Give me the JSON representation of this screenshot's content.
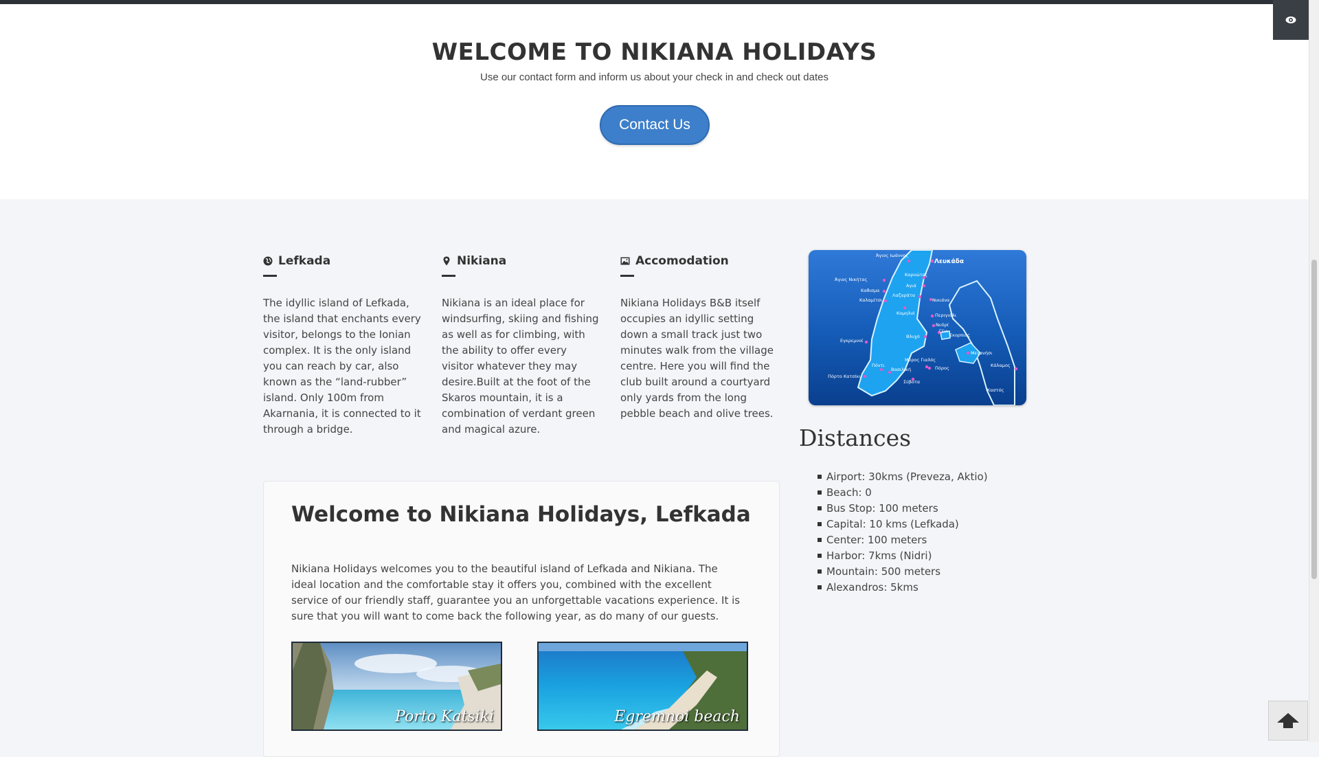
{
  "hero": {
    "title": "WELCOME TO NIKIANA HOLIDAYS",
    "subtitle": "Use our contact form and inform us about your check in and check out dates",
    "button_label": "Contact Us"
  },
  "columns": [
    {
      "icon": "globe-icon",
      "title": "Lefkada",
      "text": "The idyllic island of Lefkada, the island that enchants every visitor, belongs to the Ionian complex. It is the only island you can reach by car, also known as the “land-rubber” island. Only 100m from Akarnania, it is connected to it through a bridge."
    },
    {
      "icon": "map-marker-icon",
      "title": "Nikiana",
      "text": "Nikiana is an ideal place for windsurfing, skiing and fishing as well as for climbing, with the ability to offer every visitor whatever they may desire.Built at the foot of the Skaros mountain, it is a combination of verdant green and magical azure."
    },
    {
      "icon": "picture-icon",
      "title": "Accomodation",
      "text": "Nikiana Holidays B&B itself occupies an idyllic setting down a small track just two minutes walk from the village centre. Here you will find the club built around a courtyard only yards from the long pebble beach and olive trees."
    }
  ],
  "map": {
    "labels": [
      "Άγιος Ιωάννης",
      "Λευκάδα",
      "Καρυώτες",
      "Άγιος Νικήτας",
      "Αγιά",
      "Καθισμα",
      "Λαζαράτα",
      "Νικιάνα",
      "Καλαμίτσι",
      "Κομηλιό",
      "Περιγιάλι",
      "Νυδρί",
      "Βλυχό",
      "Γένι",
      "Σκορπιός",
      "Εγκρεμνοί",
      "Μεγανήσι",
      "Πόντι",
      "Μύρος Γιαλός",
      "Βασιλική",
      "Σύβοτα",
      "Πόρος",
      "Κάλαμος",
      "Πόρτο Κατσίκι",
      "Καστός"
    ]
  },
  "distances": {
    "title": "Distances",
    "items": [
      "Airport: 30kms (Preveza, Aktio)",
      "Beach: 0",
      "Bus Stop: 100 meters",
      "Capital: 10 kms (Lefkada)",
      "Center: 100 meters",
      "Harbor: 7kms (Nidri)",
      "Mountain: 500 meters",
      "Alexandros: 5kms"
    ]
  },
  "welcome": {
    "title": "Welcome to Nikiana Holidays, Lefkada",
    "text": "Nikiana Holidays welcomes you to the beautiful island of Lefkada and Nikiana. The ideal location and the comfortable stay it offers you, combined with the excellent service of our friendly staff, guarantee you an unforgettable vacations experience. It is sure that you will want to come back the following year, as do many of our guests.",
    "images": [
      {
        "caption": "Porto Katsiki"
      },
      {
        "caption": "Egremnoi beach"
      }
    ]
  },
  "colors": {
    "accent": "#3d7fca",
    "topbar": "#2b3136",
    "section_bg": "#f3f5f8"
  },
  "icons": {
    "eye": "eye-icon",
    "back_to_top": "arrow-up-icon"
  }
}
